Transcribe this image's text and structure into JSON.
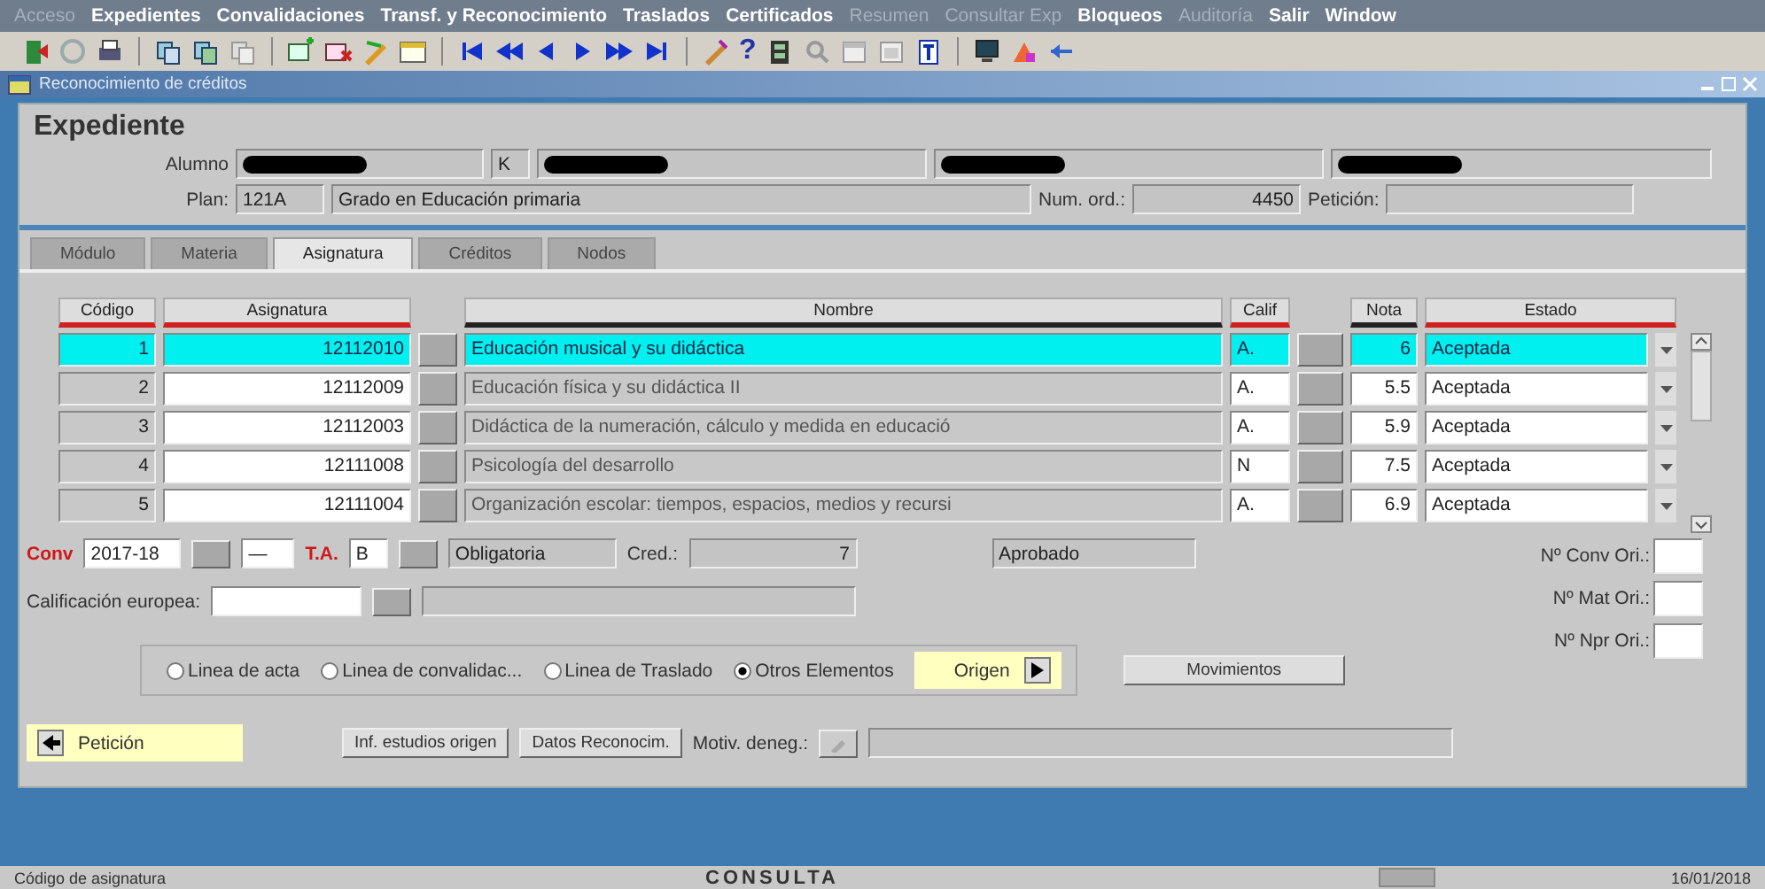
{
  "menu": [
    {
      "label": "Acceso",
      "disabled": true
    },
    {
      "label": "Expedientes",
      "disabled": false
    },
    {
      "label": "Convalidaciones",
      "disabled": false
    },
    {
      "label": "Transf. y Reconocimiento",
      "disabled": false
    },
    {
      "label": "Traslados",
      "disabled": false
    },
    {
      "label": "Certificados",
      "disabled": false
    },
    {
      "label": "Resumen",
      "disabled": true
    },
    {
      "label": "Consultar Exp",
      "disabled": true
    },
    {
      "label": "Bloqueos",
      "disabled": false
    },
    {
      "label": "Auditoría",
      "disabled": true
    },
    {
      "label": "Salir",
      "disabled": false
    },
    {
      "label": "Window",
      "disabled": false
    }
  ],
  "toolbar": {
    "help_glyph": "?"
  },
  "window": {
    "title": "Reconocimiento de créditos"
  },
  "header": {
    "title": "Expediente",
    "alumno_label": "Alumno",
    "alumno_fields": [
      {
        "kind": "redacted"
      },
      {
        "kind": "letter",
        "value": "K"
      },
      {
        "kind": "redacted"
      },
      {
        "kind": "redacted"
      },
      {
        "kind": "redacted"
      }
    ],
    "plan_label": "Plan:",
    "plan_code": "121A",
    "plan_name": "Grado en Educación primaria",
    "num_ord_label": "Num. ord.:",
    "num_ord": "4450",
    "peticion_label": "Petición:"
  },
  "tabs": [
    {
      "label": "Módulo",
      "selected": false
    },
    {
      "label": "Materia",
      "selected": false
    },
    {
      "label": "Asignatura",
      "selected": true
    },
    {
      "label": "Créditos",
      "selected": false
    },
    {
      "label": "Nodos",
      "selected": false
    }
  ],
  "table": {
    "columns": [
      {
        "label": "Código",
        "required": true
      },
      {
        "label": "Asignatura",
        "required": true
      },
      {
        "label": "Nombre",
        "required": false
      },
      {
        "label": "Calif",
        "required": true
      },
      {
        "label": "Nota",
        "required": false
      },
      {
        "label": "Estado",
        "required": true
      }
    ],
    "rows": [
      {
        "codigo": "1",
        "asignatura": "12112010",
        "nombre": "Educación musical y su didáctica",
        "calif": "A.",
        "nota": "6",
        "estado": "Aceptada",
        "selected": true
      },
      {
        "codigo": "2",
        "asignatura": "12112009",
        "nombre": "Educación física y su didáctica II",
        "calif": "A.",
        "nota": "5.5",
        "estado": "Aceptada",
        "selected": false
      },
      {
        "codigo": "3",
        "asignatura": "12112003",
        "nombre": "Didáctica de la numeración, cálculo y medida en educació",
        "calif": "A.",
        "nota": "5.9",
        "estado": "Aceptada",
        "selected": false
      },
      {
        "codigo": "4",
        "asignatura": "12111008",
        "nombre": "Psicología del desarrollo",
        "calif": "N",
        "nota": "7.5",
        "estado": "Aceptada",
        "selected": false
      },
      {
        "codigo": "5",
        "asignatura": "12111004",
        "nombre": "Organización escolar: tiempos, espacios, medios y recursi",
        "calif": "A.",
        "nota": "6.9",
        "estado": "Aceptada",
        "selected": false
      }
    ]
  },
  "detail": {
    "conv_label": "Conv",
    "conv": "2017-18",
    "conv_extra": "—",
    "ta_label": "T.A.",
    "ta": "B",
    "tipo": "Obligatoria",
    "cred_label": "Cred.:",
    "cred": "7",
    "resultado": "Aprobado",
    "europea_label": "Calificación europea:",
    "ori_fields": [
      {
        "label": "Nº Conv Ori.:"
      },
      {
        "label": "Nº Mat Ori.:"
      },
      {
        "label": "Nº Npr Ori.:"
      }
    ]
  },
  "origin_options": [
    {
      "label": "Linea de acta",
      "selected": false
    },
    {
      "label": "Linea de convalidac...",
      "selected": false
    },
    {
      "label": "Linea de Traslado",
      "selected": false
    },
    {
      "label": "Otros Elementos",
      "selected": true
    }
  ],
  "origen_button": "Origen",
  "movimientos_button": "Movimientos",
  "peticion_button": "Petición",
  "inf_button": "Inf. estudios origen",
  "datos_button": "Datos Reconocim.",
  "motiv_label": "Motiv. deneg.:",
  "status_bar": {
    "hint": "Código de asignatura",
    "mode": "CONSULTA",
    "date": "16/01/2018"
  }
}
